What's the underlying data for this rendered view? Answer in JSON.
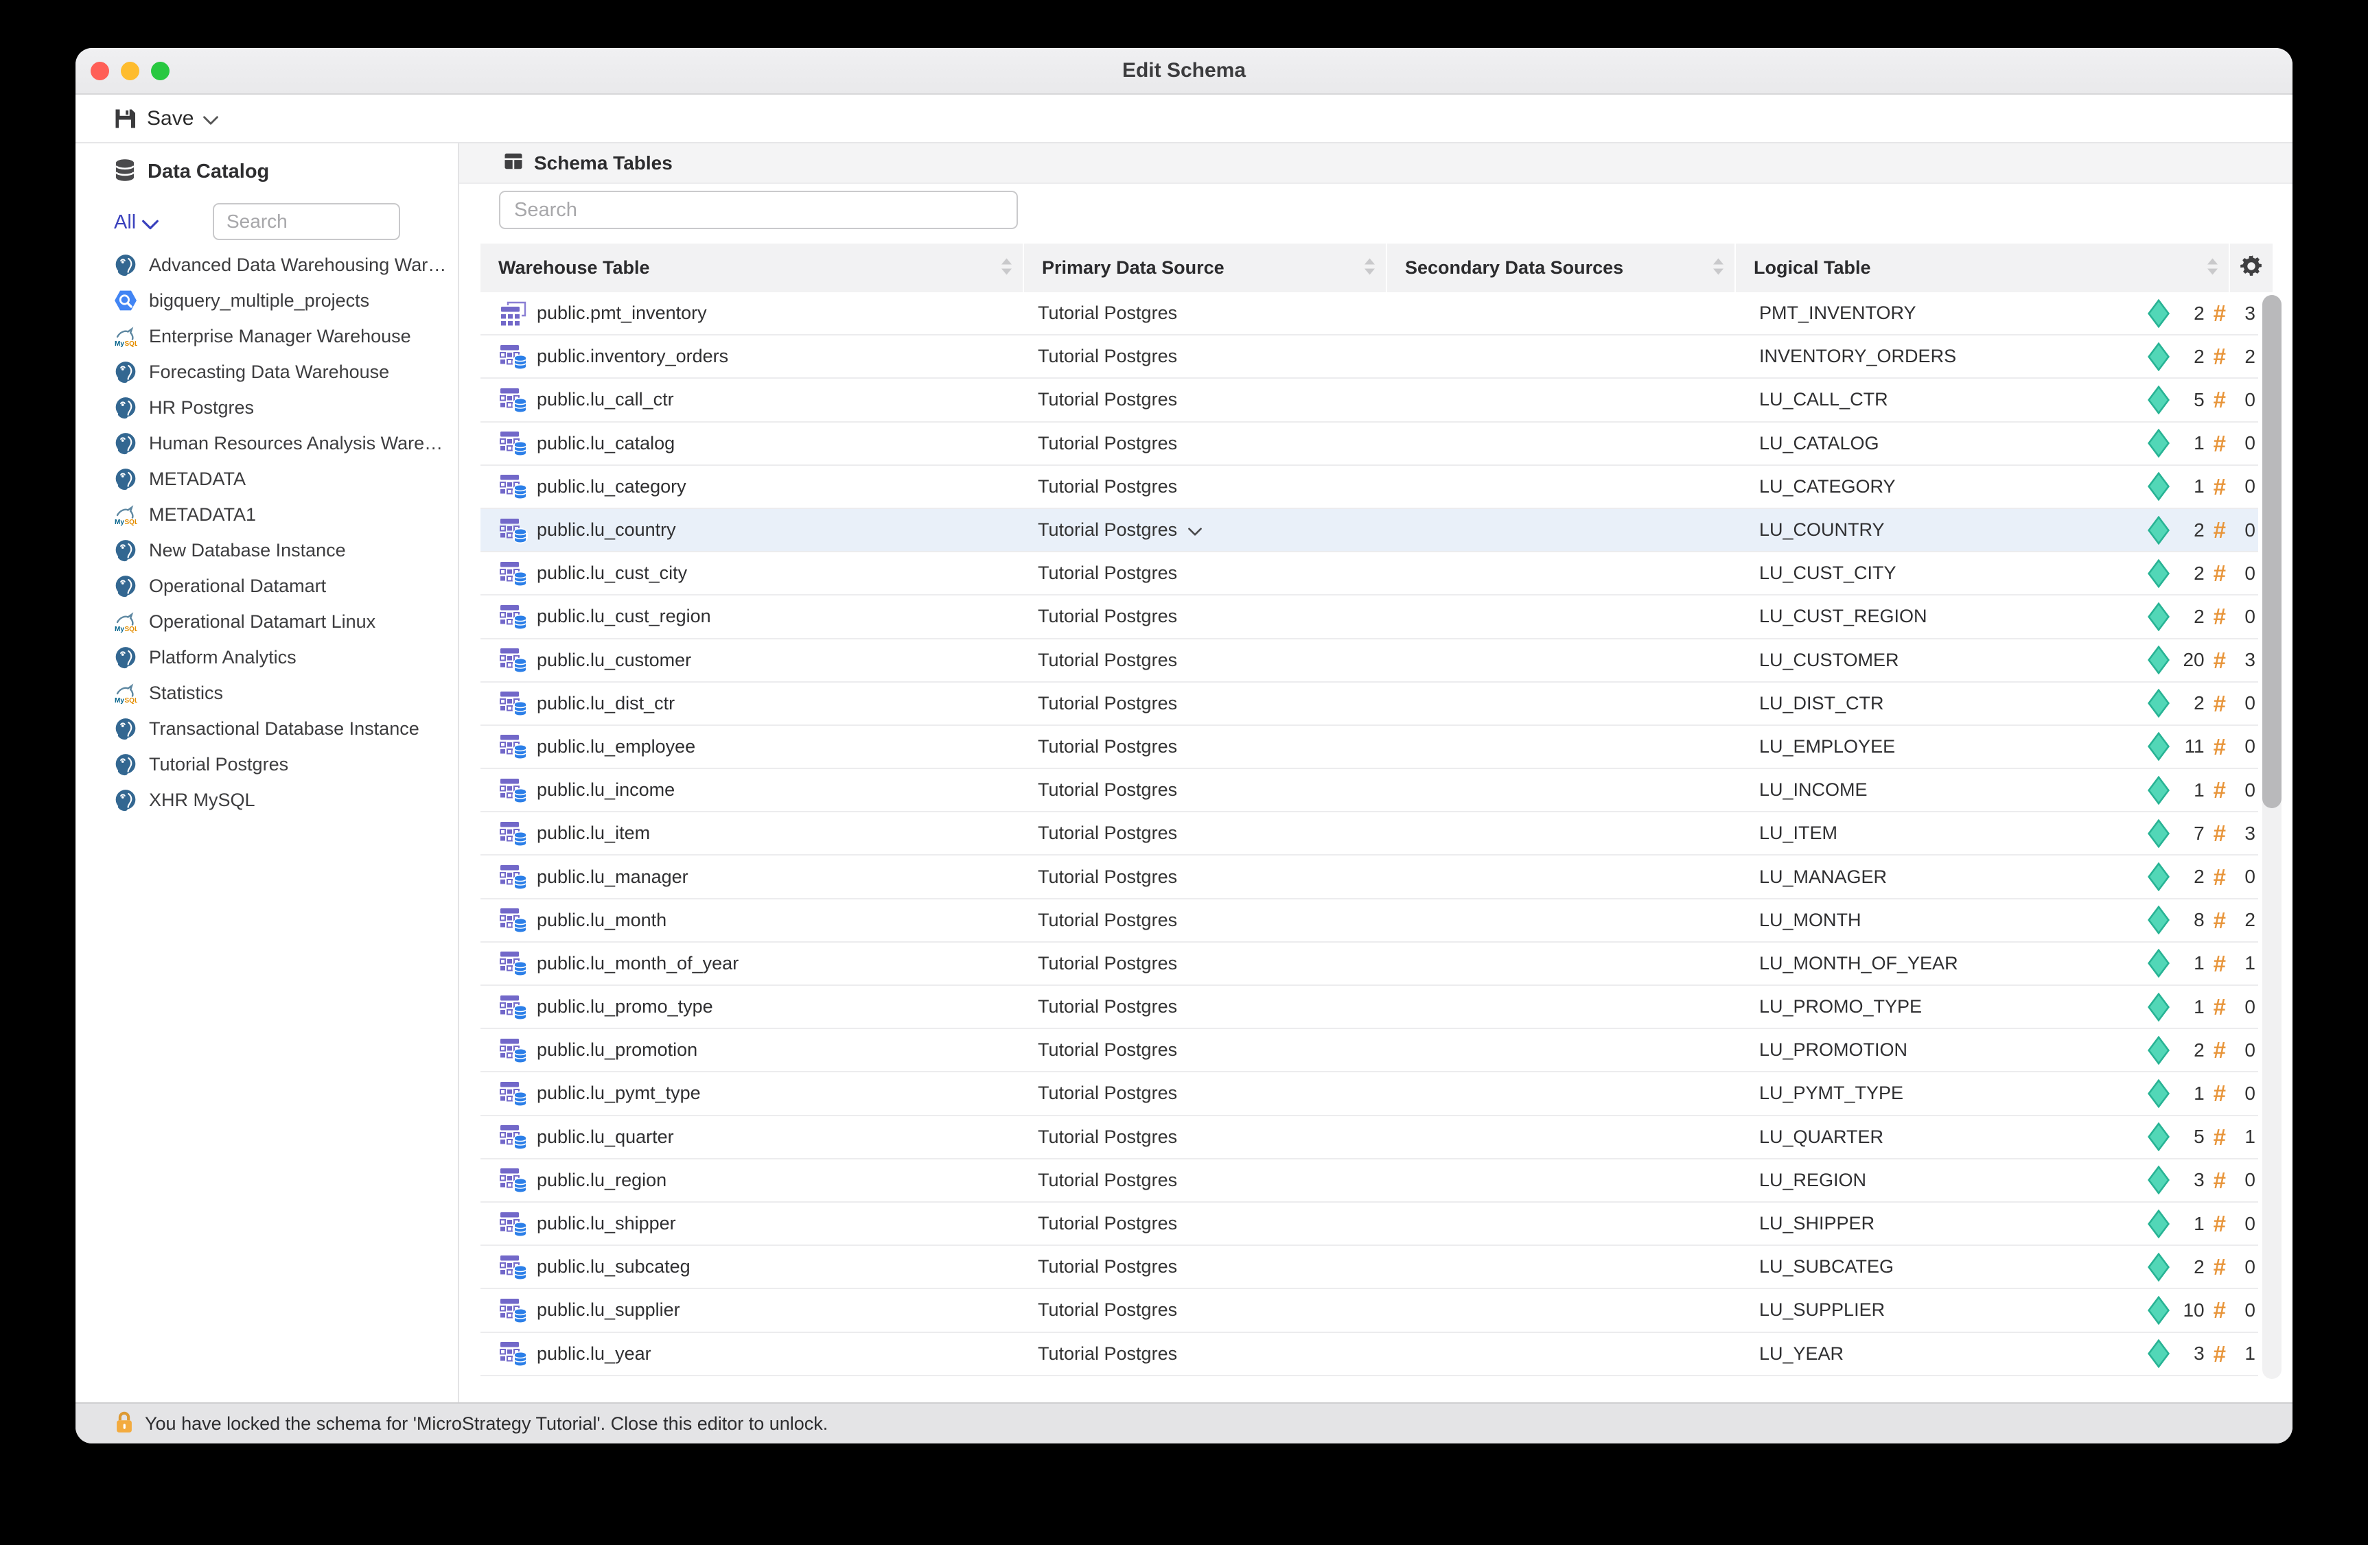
{
  "window": {
    "title": "Edit Schema"
  },
  "toolbar": {
    "save_label": "Save"
  },
  "sidebar": {
    "title": "Data Catalog",
    "filter_label": "All",
    "search_placeholder": "Search",
    "items": [
      {
        "label": "Advanced Data Warehousing War…",
        "icon": "postgres"
      },
      {
        "label": "bigquery_multiple_projects",
        "icon": "bigquery"
      },
      {
        "label": "Enterprise Manager Warehouse",
        "icon": "mysql"
      },
      {
        "label": "Forecasting Data Warehouse",
        "icon": "postgres"
      },
      {
        "label": "HR Postgres",
        "icon": "postgres"
      },
      {
        "label": "Human Resources Analysis Ware…",
        "icon": "postgres"
      },
      {
        "label": "METADATA",
        "icon": "postgres"
      },
      {
        "label": "METADATA1",
        "icon": "mysql"
      },
      {
        "label": "New Database Instance",
        "icon": "postgres"
      },
      {
        "label": "Operational Datamart",
        "icon": "postgres"
      },
      {
        "label": "Operational Datamart Linux",
        "icon": "mysql"
      },
      {
        "label": "Platform Analytics",
        "icon": "postgres"
      },
      {
        "label": "Statistics",
        "icon": "mysql"
      },
      {
        "label": "Transactional Database Instance",
        "icon": "postgres"
      },
      {
        "label": "Tutorial Postgres",
        "icon": "postgres"
      },
      {
        "label": "XHR MySQL",
        "icon": "postgres"
      }
    ]
  },
  "main": {
    "title": "Schema Tables",
    "search_placeholder": "Search",
    "columns": {
      "warehouse": "Warehouse Table",
      "primary": "Primary Data Source",
      "secondary": "Secondary Data Sources",
      "logical": "Logical Table"
    },
    "badges": {
      "fact_symbol": "#"
    },
    "rows": [
      {
        "warehouse": "public.pmt_inventory",
        "icon": "tables-stack",
        "primary": "Tutorial Postgres",
        "secondary": "",
        "logical": "PMT_INVENTORY",
        "attributes": 2,
        "facts": 3,
        "selected": false,
        "dropdown": false
      },
      {
        "warehouse": "public.inventory_orders",
        "icon": "table-db",
        "primary": "Tutorial Postgres",
        "secondary": "",
        "logical": "INVENTORY_ORDERS",
        "attributes": 2,
        "facts": 2,
        "selected": false,
        "dropdown": false
      },
      {
        "warehouse": "public.lu_call_ctr",
        "icon": "table-db",
        "primary": "Tutorial Postgres",
        "secondary": "",
        "logical": "LU_CALL_CTR",
        "attributes": 5,
        "facts": 0,
        "selected": false,
        "dropdown": false
      },
      {
        "warehouse": "public.lu_catalog",
        "icon": "table-db",
        "primary": "Tutorial Postgres",
        "secondary": "",
        "logical": "LU_CATALOG",
        "attributes": 1,
        "facts": 0,
        "selected": false,
        "dropdown": false
      },
      {
        "warehouse": "public.lu_category",
        "icon": "table-db",
        "primary": "Tutorial Postgres",
        "secondary": "",
        "logical": "LU_CATEGORY",
        "attributes": 1,
        "facts": 0,
        "selected": false,
        "dropdown": false
      },
      {
        "warehouse": "public.lu_country",
        "icon": "table-db",
        "primary": "Tutorial Postgres",
        "secondary": "",
        "logical": "LU_COUNTRY",
        "attributes": 2,
        "facts": 0,
        "selected": true,
        "dropdown": true
      },
      {
        "warehouse": "public.lu_cust_city",
        "icon": "table-db",
        "primary": "Tutorial Postgres",
        "secondary": "",
        "logical": "LU_CUST_CITY",
        "attributes": 2,
        "facts": 0,
        "selected": false,
        "dropdown": false
      },
      {
        "warehouse": "public.lu_cust_region",
        "icon": "table-db",
        "primary": "Tutorial Postgres",
        "secondary": "",
        "logical": "LU_CUST_REGION",
        "attributes": 2,
        "facts": 0,
        "selected": false,
        "dropdown": false
      },
      {
        "warehouse": "public.lu_customer",
        "icon": "table-db",
        "primary": "Tutorial Postgres",
        "secondary": "",
        "logical": "LU_CUSTOMER",
        "attributes": 20,
        "facts": 3,
        "selected": false,
        "dropdown": false
      },
      {
        "warehouse": "public.lu_dist_ctr",
        "icon": "table-db",
        "primary": "Tutorial Postgres",
        "secondary": "",
        "logical": "LU_DIST_CTR",
        "attributes": 2,
        "facts": 0,
        "selected": false,
        "dropdown": false
      },
      {
        "warehouse": "public.lu_employee",
        "icon": "table-db",
        "primary": "Tutorial Postgres",
        "secondary": "",
        "logical": "LU_EMPLOYEE",
        "attributes": 11,
        "facts": 0,
        "selected": false,
        "dropdown": false
      },
      {
        "warehouse": "public.lu_income",
        "icon": "table-db",
        "primary": "Tutorial Postgres",
        "secondary": "",
        "logical": "LU_INCOME",
        "attributes": 1,
        "facts": 0,
        "selected": false,
        "dropdown": false
      },
      {
        "warehouse": "public.lu_item",
        "icon": "table-db",
        "primary": "Tutorial Postgres",
        "secondary": "",
        "logical": "LU_ITEM",
        "attributes": 7,
        "facts": 3,
        "selected": false,
        "dropdown": false
      },
      {
        "warehouse": "public.lu_manager",
        "icon": "table-db",
        "primary": "Tutorial Postgres",
        "secondary": "",
        "logical": "LU_MANAGER",
        "attributes": 2,
        "facts": 0,
        "selected": false,
        "dropdown": false
      },
      {
        "warehouse": "public.lu_month",
        "icon": "table-db",
        "primary": "Tutorial Postgres",
        "secondary": "",
        "logical": "LU_MONTH",
        "attributes": 8,
        "facts": 2,
        "selected": false,
        "dropdown": false
      },
      {
        "warehouse": "public.lu_month_of_year",
        "icon": "table-db",
        "primary": "Tutorial Postgres",
        "secondary": "",
        "logical": "LU_MONTH_OF_YEAR",
        "attributes": 1,
        "facts": 1,
        "selected": false,
        "dropdown": false
      },
      {
        "warehouse": "public.lu_promo_type",
        "icon": "table-db",
        "primary": "Tutorial Postgres",
        "secondary": "",
        "logical": "LU_PROMO_TYPE",
        "attributes": 1,
        "facts": 0,
        "selected": false,
        "dropdown": false
      },
      {
        "warehouse": "public.lu_promotion",
        "icon": "table-db",
        "primary": "Tutorial Postgres",
        "secondary": "",
        "logical": "LU_PROMOTION",
        "attributes": 2,
        "facts": 0,
        "selected": false,
        "dropdown": false
      },
      {
        "warehouse": "public.lu_pymt_type",
        "icon": "table-db",
        "primary": "Tutorial Postgres",
        "secondary": "",
        "logical": "LU_PYMT_TYPE",
        "attributes": 1,
        "facts": 0,
        "selected": false,
        "dropdown": false
      },
      {
        "warehouse": "public.lu_quarter",
        "icon": "table-db",
        "primary": "Tutorial Postgres",
        "secondary": "",
        "logical": "LU_QUARTER",
        "attributes": 5,
        "facts": 1,
        "selected": false,
        "dropdown": false
      },
      {
        "warehouse": "public.lu_region",
        "icon": "table-db",
        "primary": "Tutorial Postgres",
        "secondary": "",
        "logical": "LU_REGION",
        "attributes": 3,
        "facts": 0,
        "selected": false,
        "dropdown": false
      },
      {
        "warehouse": "public.lu_shipper",
        "icon": "table-db",
        "primary": "Tutorial Postgres",
        "secondary": "",
        "logical": "LU_SHIPPER",
        "attributes": 1,
        "facts": 0,
        "selected": false,
        "dropdown": false
      },
      {
        "warehouse": "public.lu_subcateg",
        "icon": "table-db",
        "primary": "Tutorial Postgres",
        "secondary": "",
        "logical": "LU_SUBCATEG",
        "attributes": 2,
        "facts": 0,
        "selected": false,
        "dropdown": false
      },
      {
        "warehouse": "public.lu_supplier",
        "icon": "table-db",
        "primary": "Tutorial Postgres",
        "secondary": "",
        "logical": "LU_SUPPLIER",
        "attributes": 10,
        "facts": 0,
        "selected": false,
        "dropdown": false
      },
      {
        "warehouse": "public.lu_year",
        "icon": "table-db",
        "primary": "Tutorial Postgres",
        "secondary": "",
        "logical": "LU_YEAR",
        "attributes": 3,
        "facts": 1,
        "selected": false,
        "dropdown": false
      }
    ]
  },
  "status_bar": {
    "message": "You have locked the schema for 'MicroStrategy Tutorial'. Close this editor to unlock."
  },
  "colors": {
    "attribute_diamond": "#52d7b7",
    "fact_hash": "#e8953a",
    "selected_row": "#e9f0f9",
    "filter_link": "#3a41bd",
    "postgres_blue": "#336791",
    "table_icon_purple": "#7268c9",
    "table_icon_db_blue": "#2c7fe8"
  }
}
